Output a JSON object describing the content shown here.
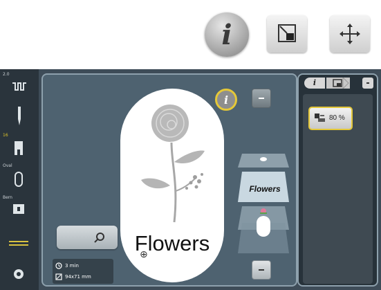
{
  "toolbar": {
    "info_glyph": "i",
    "icons": [
      "info-icon",
      "resize-frame-icon",
      "move-arrows-icon"
    ]
  },
  "sidebar": {
    "items": [
      {
        "label": "2.0",
        "icon": "stitch-width-icon"
      },
      {
        "label": "",
        "icon": "needle-icon"
      },
      {
        "label": "16",
        "icon": "presser-foot-icon"
      },
      {
        "label": "Oval",
        "icon": "hoop-oval-icon"
      },
      {
        "label": "Bern",
        "icon": "stitch-plate-icon"
      },
      {
        "label": "",
        "icon": "thread-icon"
      },
      {
        "label": "",
        "icon": "settings-gear-icon"
      }
    ]
  },
  "canvas": {
    "design_text": "Flowers",
    "layer_label": "Flowers",
    "info_glyph": "i"
  },
  "status": {
    "time": "3 min",
    "size": "94x71 mm"
  },
  "panel": {
    "tab_info_glyph": "i",
    "zoom_value": "80 %"
  },
  "colors": {
    "accent_yellow": "#e5c838",
    "screen_bg": "#3e4c58",
    "hoop_white": "#ffffff"
  }
}
